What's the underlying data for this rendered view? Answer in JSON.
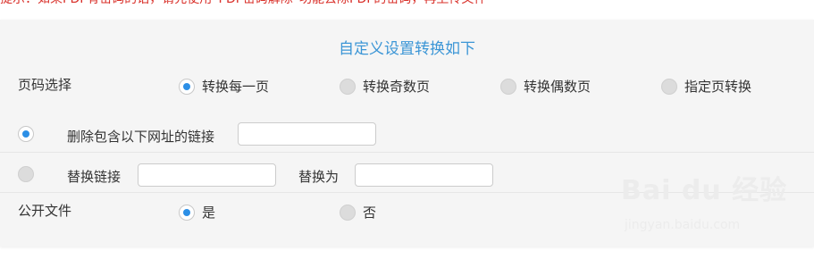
{
  "top_note": "提示：如果PDF有密码的话，请先使用“PDF密码解除”功能去除PDF的密码，再上传文件",
  "panel": {
    "title": "自定义设置转换如下",
    "page_select": {
      "label": "页码选择",
      "options": [
        {
          "label": "转换每一页",
          "checked": true
        },
        {
          "label": "转换奇数页",
          "checked": false
        },
        {
          "label": "转换偶数页",
          "checked": false
        },
        {
          "label": "指定页转换",
          "checked": false
        }
      ]
    },
    "delete_links": {
      "label": "删除包含以下网址的链接",
      "checked": true,
      "value": "",
      "placeholder": ""
    },
    "replace_links": {
      "label": "替换链接",
      "checked": false,
      "value": "",
      "placeholder": "",
      "replace_with_label": "替换为",
      "replace_with_value": "",
      "replace_with_placeholder": ""
    },
    "public_file": {
      "label": "公开文件",
      "options": [
        {
          "label": "是",
          "checked": true
        },
        {
          "label": "否",
          "checked": false
        }
      ]
    }
  },
  "watermark": {
    "main": "Bai du 经验",
    "sub": "jingyan.baidu.com"
  },
  "colors": {
    "accent": "#2c8fe6",
    "title": "#3c96d6",
    "note": "#d9302a",
    "panel_bg": "#f5f5f5"
  }
}
